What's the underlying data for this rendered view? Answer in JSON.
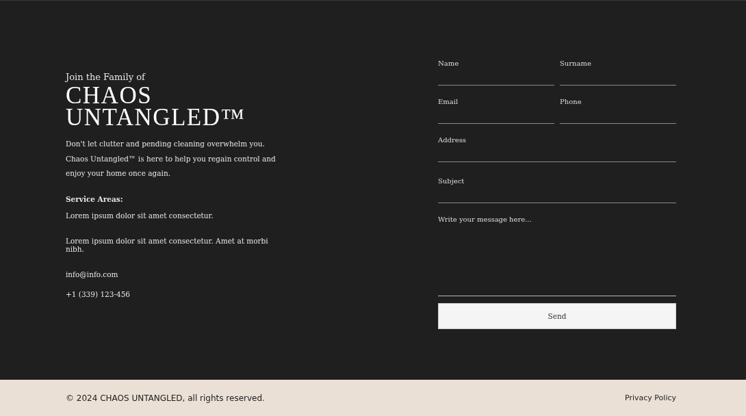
{
  "intro": {
    "eyebrow": "Join the Family of",
    "title_lines": [
      "CHAOS",
      "UNTANGLED™"
    ],
    "description": "Don't let clutter and pending cleaning overwhelm you. Chaos Untangled™ is here to help you regain control and enjoy your home once again.",
    "service_heading": "Service Areas:",
    "service_areas": [
      "Lorem ipsum dolor sit amet consectetur.",
      "Lorem ipsum dolor sit amet consectetur. Amet at morbi nibh."
    ],
    "email": "info@info.com",
    "phone": "+1 (339) 123-456"
  },
  "form": {
    "fields": [
      {
        "label": "Name",
        "kind": "half"
      },
      {
        "label": "Surname",
        "kind": "half"
      },
      {
        "label": "Email",
        "kind": "half"
      },
      {
        "label": "Phone",
        "kind": "half"
      },
      {
        "label": "Address",
        "kind": "full"
      },
      {
        "label": "Subject",
        "kind": "full"
      },
      {
        "placeholder": "Write your message here...",
        "kind": "message"
      }
    ],
    "button": "Send"
  },
  "footer": {
    "copyright": "© 2024 CHAOS UNTANGLED, all rights reserved.",
    "link": "Privacy Policy"
  }
}
